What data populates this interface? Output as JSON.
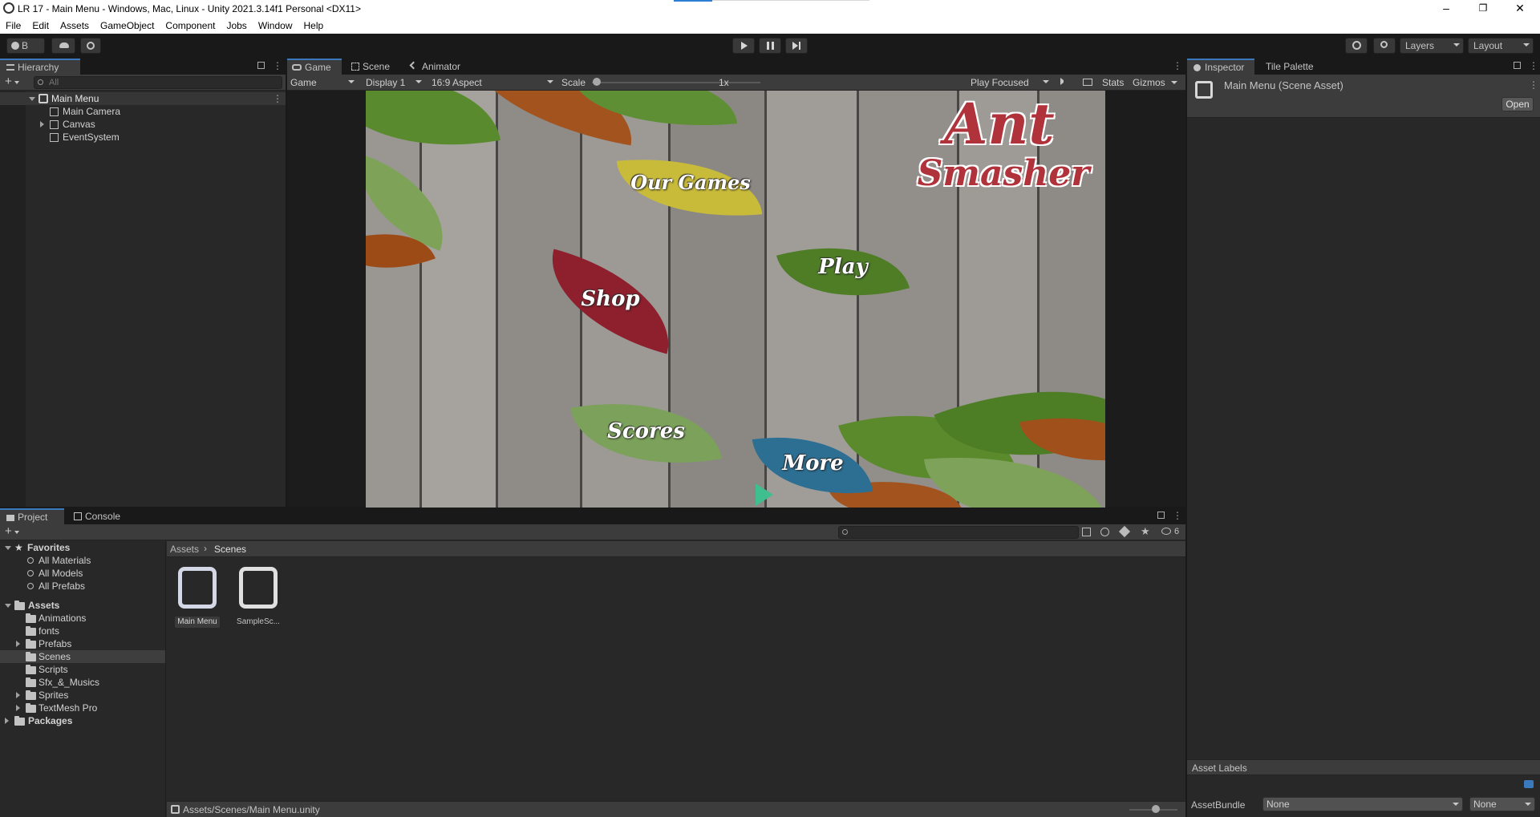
{
  "window": {
    "title": "LR 17 - Main Menu - Windows, Mac, Linux - Unity 2021.3.14f1 Personal <DX11>",
    "minimize": "–",
    "restore": "❐",
    "close": "✕"
  },
  "menu": [
    "File",
    "Edit",
    "Assets",
    "GameObject",
    "Component",
    "Jobs",
    "Window",
    "Help"
  ],
  "toolbar": {
    "account": "B",
    "layers_label": "Layers",
    "layout_label": "Layout"
  },
  "hierarchy": {
    "tab": "Hierarchy",
    "search_placeholder": "All",
    "scene": "Main Menu",
    "items": [
      "Main Camera",
      "Canvas",
      "EventSystem"
    ]
  },
  "game_view": {
    "tabs": [
      "Game",
      "Scene",
      "Animator"
    ],
    "mode": "Game",
    "display": "Display 1",
    "aspect": "16:9 Aspect",
    "scale_label": "Scale",
    "scale_value": "1x",
    "play_mode": "Play Focused",
    "stats": "Stats",
    "gizmos": "Gizmos",
    "scene_title_line1": "Ant",
    "scene_title_line2": "Smasher",
    "buttons": {
      "our_games": "Our Games",
      "play": "Play",
      "shop": "Shop",
      "scores": "Scores",
      "more": "More"
    }
  },
  "inspector": {
    "tabs": [
      "Inspector",
      "Tile Palette"
    ],
    "asset_title": "Main Menu (Scene Asset)",
    "open_button": "Open",
    "asset_labels": "Asset Labels",
    "assetbundle_label": "AssetBundle",
    "assetbundle_value": "None",
    "variant_value": "None"
  },
  "project": {
    "tabs": [
      "Project",
      "Console"
    ],
    "favorites_label": "Favorites",
    "favorites": [
      "All Materials",
      "All Models",
      "All Prefabs"
    ],
    "assets_label": "Assets",
    "asset_folders": [
      "Animations",
      "fonts",
      "Prefabs",
      "Scenes",
      "Scripts",
      "Sfx_&_Musics",
      "Sprites",
      "TextMesh Pro"
    ],
    "packages_label": "Packages",
    "breadcrumb_root": "Assets",
    "breadcrumb_current": "Scenes",
    "hidden_count": "6",
    "files": [
      "Main Menu",
      "SampleSc..."
    ],
    "status_path": "Assets/Scenes/Main Menu.unity"
  },
  "colors": {
    "selection": "#2c5d87",
    "accent_tab": "#3a79bb",
    "panel_bg": "#282828"
  }
}
